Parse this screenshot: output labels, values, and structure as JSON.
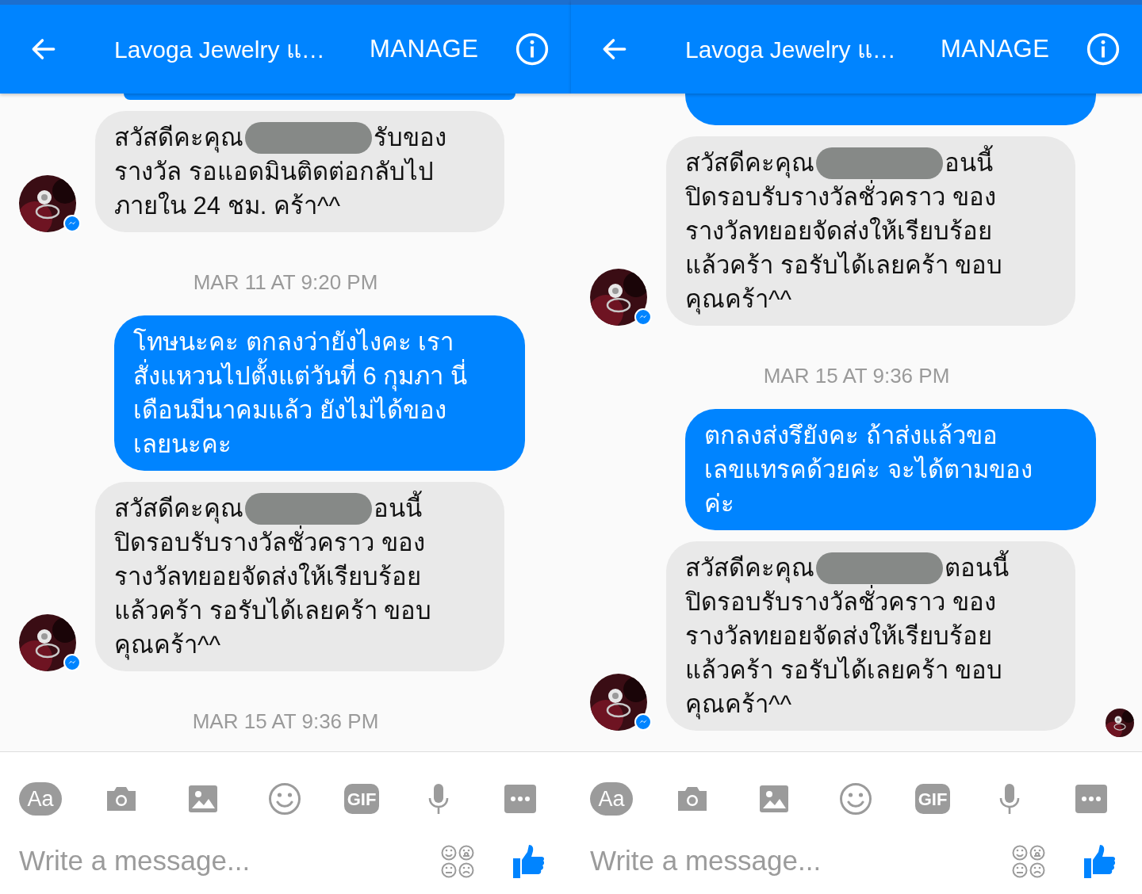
{
  "panels": [
    {
      "header": {
        "title": "Lavoga Jewelry แ…",
        "action": "MANAGE"
      },
      "clipped_sent_bubble_above": true,
      "messages": [
        {
          "kind": "received",
          "avatar": true,
          "redacted": true,
          "head": "สวัสดีคะคุณ",
          "tail": "รับของ",
          "lines": [
            "รางวัล รอแอดมินติดต่อกลับไป",
            "ภายใน 24 ชม. คร้า^^"
          ]
        },
        {
          "kind": "timestamp",
          "text": "MAR 11 AT 9:20 PM"
        },
        {
          "kind": "sent",
          "lines": [
            "โทษนะคะ ตกลงว่ายังไงคะ เรา",
            "สั่งแหวนไปตั้งแต่วันที่ 6 กุมภา นี่",
            "เดือนมีนาคมแล้ว ยังไม่ได้ของ",
            "เลยนะคะ"
          ]
        },
        {
          "kind": "received",
          "avatar": true,
          "redacted": true,
          "head": "สวัสดีคะคุณ",
          "tail": "อนนี้",
          "lines": [
            "ปิดรอบรับรางวัลชั่วคราว ของ",
            "รางวัลทยอยจัดส่งให้เรียบร้อย",
            "แล้วคร้า รอรับได้เลยคร้า ขอบ",
            "คุณคร้า^^"
          ]
        },
        {
          "kind": "timestamp",
          "text": "MAR 15 AT 9:36 PM"
        }
      ],
      "toolbar": [
        {
          "kind": "text",
          "label": "Aa"
        },
        {
          "kind": "camera"
        },
        {
          "kind": "image"
        },
        {
          "kind": "emoji"
        },
        {
          "kind": "gif",
          "label": "GIF"
        },
        {
          "kind": "mic"
        },
        {
          "kind": "more"
        }
      ],
      "composer": {
        "placeholder": "Write a message..."
      }
    },
    {
      "header": {
        "title": "Lavoga Jewelry แ…",
        "action": "MANAGE"
      },
      "clipped_sent_bubble_above": true,
      "messages": [
        {
          "kind": "received",
          "avatar": true,
          "redacted": true,
          "head": "สวัสดีคะคุณ",
          "tail": "อนนี้",
          "lines": [
            "ปิดรอบรับรางวัลชั่วคราว ของ",
            "รางวัลทยอยจัดส่งให้เรียบร้อย",
            "แล้วคร้า รอรับได้เลยคร้า ขอบ",
            "คุณคร้า^^"
          ]
        },
        {
          "kind": "timestamp",
          "text": "MAR 15 AT 9:36 PM"
        },
        {
          "kind": "sent",
          "lines": [
            "ตกลงส่งรึยังคะ ถ้าส่งแล้วขอ",
            "เลขแทรคด้วยค่ะ จะได้ตามของ",
            "ค่ะ"
          ]
        },
        {
          "kind": "received",
          "avatar": true,
          "redacted": true,
          "head": "สวัสดีคะคุณ",
          "tail": "ตอนนี้",
          "lines": [
            "ปิดรอบรับรางวัลชั่วคราว ของ",
            "รางวัลทยอยจัดส่งให้เรียบร้อย",
            "แล้วคร้า รอรับได้เลยคร้า ขอบ",
            "คุณคร้า^^"
          ]
        }
      ],
      "read_receipt": true,
      "toolbar": [
        {
          "kind": "text",
          "label": "Aa"
        },
        {
          "kind": "camera"
        },
        {
          "kind": "image"
        },
        {
          "kind": "emoji"
        },
        {
          "kind": "gif",
          "label": "GIF"
        },
        {
          "kind": "mic"
        },
        {
          "kind": "more"
        }
      ],
      "composer": {
        "placeholder": "Write a message..."
      }
    }
  ]
}
